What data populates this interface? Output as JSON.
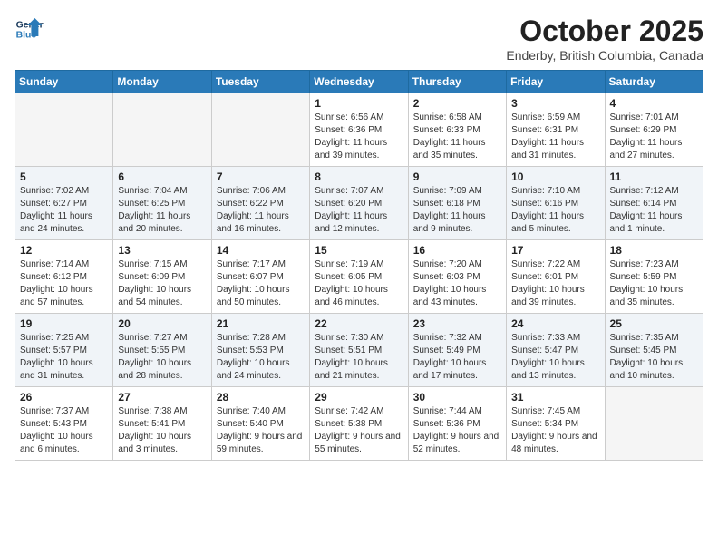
{
  "header": {
    "logo_line1": "General",
    "logo_line2": "Blue",
    "month": "October 2025",
    "location": "Enderby, British Columbia, Canada"
  },
  "weekdays": [
    "Sunday",
    "Monday",
    "Tuesday",
    "Wednesday",
    "Thursday",
    "Friday",
    "Saturday"
  ],
  "weeks": [
    [
      {
        "day": "",
        "info": ""
      },
      {
        "day": "",
        "info": ""
      },
      {
        "day": "",
        "info": ""
      },
      {
        "day": "1",
        "info": "Sunrise: 6:56 AM\nSunset: 6:36 PM\nDaylight: 11 hours\nand 39 minutes."
      },
      {
        "day": "2",
        "info": "Sunrise: 6:58 AM\nSunset: 6:33 PM\nDaylight: 11 hours\nand 35 minutes."
      },
      {
        "day": "3",
        "info": "Sunrise: 6:59 AM\nSunset: 6:31 PM\nDaylight: 11 hours\nand 31 minutes."
      },
      {
        "day": "4",
        "info": "Sunrise: 7:01 AM\nSunset: 6:29 PM\nDaylight: 11 hours\nand 27 minutes."
      }
    ],
    [
      {
        "day": "5",
        "info": "Sunrise: 7:02 AM\nSunset: 6:27 PM\nDaylight: 11 hours\nand 24 minutes."
      },
      {
        "day": "6",
        "info": "Sunrise: 7:04 AM\nSunset: 6:25 PM\nDaylight: 11 hours\nand 20 minutes."
      },
      {
        "day": "7",
        "info": "Sunrise: 7:06 AM\nSunset: 6:22 PM\nDaylight: 11 hours\nand 16 minutes."
      },
      {
        "day": "8",
        "info": "Sunrise: 7:07 AM\nSunset: 6:20 PM\nDaylight: 11 hours\nand 12 minutes."
      },
      {
        "day": "9",
        "info": "Sunrise: 7:09 AM\nSunset: 6:18 PM\nDaylight: 11 hours\nand 9 minutes."
      },
      {
        "day": "10",
        "info": "Sunrise: 7:10 AM\nSunset: 6:16 PM\nDaylight: 11 hours\nand 5 minutes."
      },
      {
        "day": "11",
        "info": "Sunrise: 7:12 AM\nSunset: 6:14 PM\nDaylight: 11 hours\nand 1 minute."
      }
    ],
    [
      {
        "day": "12",
        "info": "Sunrise: 7:14 AM\nSunset: 6:12 PM\nDaylight: 10 hours\nand 57 minutes."
      },
      {
        "day": "13",
        "info": "Sunrise: 7:15 AM\nSunset: 6:09 PM\nDaylight: 10 hours\nand 54 minutes."
      },
      {
        "day": "14",
        "info": "Sunrise: 7:17 AM\nSunset: 6:07 PM\nDaylight: 10 hours\nand 50 minutes."
      },
      {
        "day": "15",
        "info": "Sunrise: 7:19 AM\nSunset: 6:05 PM\nDaylight: 10 hours\nand 46 minutes."
      },
      {
        "day": "16",
        "info": "Sunrise: 7:20 AM\nSunset: 6:03 PM\nDaylight: 10 hours\nand 43 minutes."
      },
      {
        "day": "17",
        "info": "Sunrise: 7:22 AM\nSunset: 6:01 PM\nDaylight: 10 hours\nand 39 minutes."
      },
      {
        "day": "18",
        "info": "Sunrise: 7:23 AM\nSunset: 5:59 PM\nDaylight: 10 hours\nand 35 minutes."
      }
    ],
    [
      {
        "day": "19",
        "info": "Sunrise: 7:25 AM\nSunset: 5:57 PM\nDaylight: 10 hours\nand 31 minutes."
      },
      {
        "day": "20",
        "info": "Sunrise: 7:27 AM\nSunset: 5:55 PM\nDaylight: 10 hours\nand 28 minutes."
      },
      {
        "day": "21",
        "info": "Sunrise: 7:28 AM\nSunset: 5:53 PM\nDaylight: 10 hours\nand 24 minutes."
      },
      {
        "day": "22",
        "info": "Sunrise: 7:30 AM\nSunset: 5:51 PM\nDaylight: 10 hours\nand 21 minutes."
      },
      {
        "day": "23",
        "info": "Sunrise: 7:32 AM\nSunset: 5:49 PM\nDaylight: 10 hours\nand 17 minutes."
      },
      {
        "day": "24",
        "info": "Sunrise: 7:33 AM\nSunset: 5:47 PM\nDaylight: 10 hours\nand 13 minutes."
      },
      {
        "day": "25",
        "info": "Sunrise: 7:35 AM\nSunset: 5:45 PM\nDaylight: 10 hours\nand 10 minutes."
      }
    ],
    [
      {
        "day": "26",
        "info": "Sunrise: 7:37 AM\nSunset: 5:43 PM\nDaylight: 10 hours\nand 6 minutes."
      },
      {
        "day": "27",
        "info": "Sunrise: 7:38 AM\nSunset: 5:41 PM\nDaylight: 10 hours\nand 3 minutes."
      },
      {
        "day": "28",
        "info": "Sunrise: 7:40 AM\nSunset: 5:40 PM\nDaylight: 9 hours\nand 59 minutes."
      },
      {
        "day": "29",
        "info": "Sunrise: 7:42 AM\nSunset: 5:38 PM\nDaylight: 9 hours\nand 55 minutes."
      },
      {
        "day": "30",
        "info": "Sunrise: 7:44 AM\nSunset: 5:36 PM\nDaylight: 9 hours\nand 52 minutes."
      },
      {
        "day": "31",
        "info": "Sunrise: 7:45 AM\nSunset: 5:34 PM\nDaylight: 9 hours\nand 48 minutes."
      },
      {
        "day": "",
        "info": ""
      }
    ]
  ]
}
